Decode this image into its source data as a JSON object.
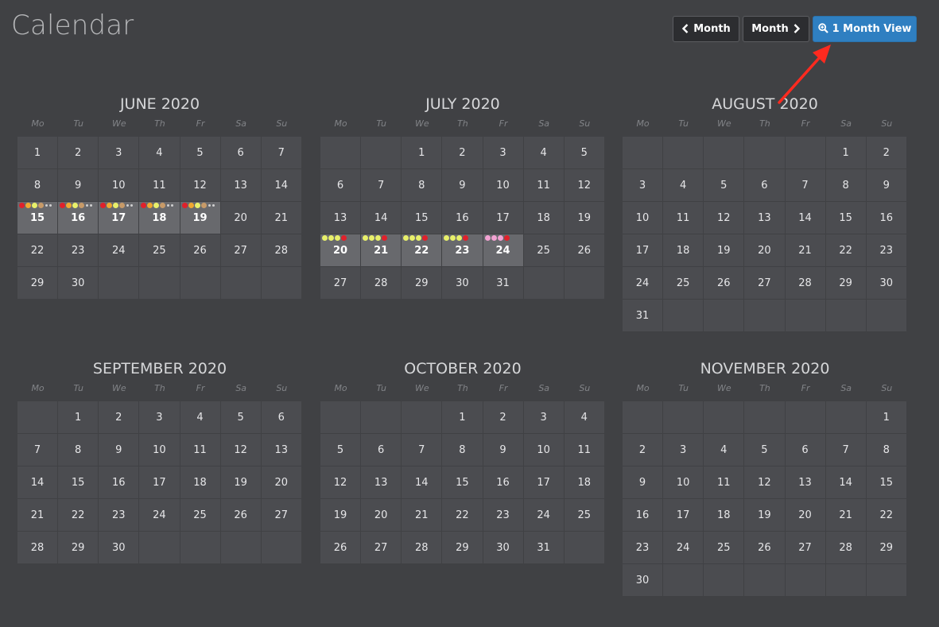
{
  "header": {
    "title": "Calendar",
    "prev_label": "Month",
    "next_label": "Month",
    "view_label": "1 Month View",
    "prev_icon": "chevron-left-icon",
    "next_icon": "chevron-right-icon",
    "view_icon": "zoom-in-icon"
  },
  "weekdays": [
    "Mo",
    "Tu",
    "We",
    "Th",
    "Fr",
    "Sa",
    "Su"
  ],
  "colors": {
    "accent": "#2f7fc1",
    "red": "#e0212b",
    "orange": "#f0a830",
    "yellow": "#e8f06a",
    "tan": "#c79a68",
    "pink": "#f2a2d2",
    "annotation_arrow": "#ff2a1f"
  },
  "months": [
    {
      "title": "JUNE 2020",
      "offset": 0,
      "days": 30,
      "highlights": [
        {
          "day": 15,
          "dots": [
            "red",
            "orange",
            "yellow",
            "tan"
          ],
          "more": true
        },
        {
          "day": 16,
          "dots": [
            "red",
            "orange",
            "yellow",
            "tan"
          ],
          "more": true
        },
        {
          "day": 17,
          "dots": [
            "red",
            "orange",
            "yellow",
            "tan"
          ],
          "more": true
        },
        {
          "day": 18,
          "dots": [
            "red",
            "orange",
            "yellow",
            "tan"
          ],
          "more": true
        },
        {
          "day": 19,
          "dots": [
            "red",
            "orange",
            "yellow",
            "tan"
          ],
          "more": true
        }
      ]
    },
    {
      "title": "JULY 2020",
      "offset": 2,
      "days": 31,
      "highlights": [
        {
          "day": 20,
          "dots": [
            "yellow",
            "yellow",
            "yellow",
            "red"
          ],
          "more": false
        },
        {
          "day": 21,
          "dots": [
            "yellow",
            "yellow",
            "yellow",
            "red"
          ],
          "more": false
        },
        {
          "day": 22,
          "dots": [
            "yellow",
            "yellow",
            "yellow",
            "red"
          ],
          "more": false
        },
        {
          "day": 23,
          "dots": [
            "yellow",
            "yellow",
            "yellow",
            "red"
          ],
          "more": false
        },
        {
          "day": 24,
          "dots": [
            "pink",
            "pink",
            "pink",
            "red"
          ],
          "more": false
        }
      ]
    },
    {
      "title": "AUGUST 2020",
      "offset": 5,
      "days": 31,
      "highlights": []
    },
    {
      "title": "SEPTEMBER 2020",
      "offset": 1,
      "days": 30,
      "highlights": []
    },
    {
      "title": "OCTOBER 2020",
      "offset": 3,
      "days": 31,
      "highlights": []
    },
    {
      "title": "NOVEMBER 2020",
      "offset": 6,
      "days": 30,
      "highlights": []
    }
  ]
}
